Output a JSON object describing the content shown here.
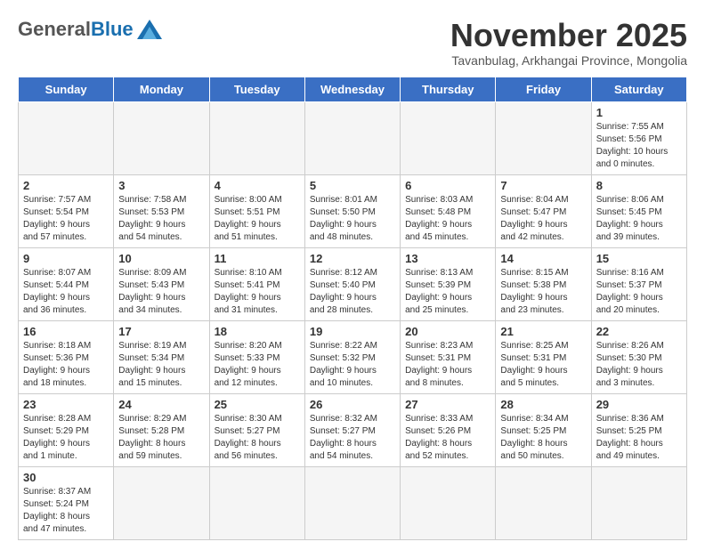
{
  "header": {
    "logo_general": "General",
    "logo_blue": "Blue",
    "month_title": "November 2025",
    "subtitle": "Tavanbulag, Arkhangai Province, Mongolia"
  },
  "weekdays": [
    "Sunday",
    "Monday",
    "Tuesday",
    "Wednesday",
    "Thursday",
    "Friday",
    "Saturday"
  ],
  "weeks": [
    [
      {
        "day": "",
        "info": ""
      },
      {
        "day": "",
        "info": ""
      },
      {
        "day": "",
        "info": ""
      },
      {
        "day": "",
        "info": ""
      },
      {
        "day": "",
        "info": ""
      },
      {
        "day": "",
        "info": ""
      },
      {
        "day": "1",
        "info": "Sunrise: 7:55 AM\nSunset: 5:56 PM\nDaylight: 10 hours\nand 0 minutes."
      }
    ],
    [
      {
        "day": "2",
        "info": "Sunrise: 7:57 AM\nSunset: 5:54 PM\nDaylight: 9 hours\nand 57 minutes."
      },
      {
        "day": "3",
        "info": "Sunrise: 7:58 AM\nSunset: 5:53 PM\nDaylight: 9 hours\nand 54 minutes."
      },
      {
        "day": "4",
        "info": "Sunrise: 8:00 AM\nSunset: 5:51 PM\nDaylight: 9 hours\nand 51 minutes."
      },
      {
        "day": "5",
        "info": "Sunrise: 8:01 AM\nSunset: 5:50 PM\nDaylight: 9 hours\nand 48 minutes."
      },
      {
        "day": "6",
        "info": "Sunrise: 8:03 AM\nSunset: 5:48 PM\nDaylight: 9 hours\nand 45 minutes."
      },
      {
        "day": "7",
        "info": "Sunrise: 8:04 AM\nSunset: 5:47 PM\nDaylight: 9 hours\nand 42 minutes."
      },
      {
        "day": "8",
        "info": "Sunrise: 8:06 AM\nSunset: 5:45 PM\nDaylight: 9 hours\nand 39 minutes."
      }
    ],
    [
      {
        "day": "9",
        "info": "Sunrise: 8:07 AM\nSunset: 5:44 PM\nDaylight: 9 hours\nand 36 minutes."
      },
      {
        "day": "10",
        "info": "Sunrise: 8:09 AM\nSunset: 5:43 PM\nDaylight: 9 hours\nand 34 minutes."
      },
      {
        "day": "11",
        "info": "Sunrise: 8:10 AM\nSunset: 5:41 PM\nDaylight: 9 hours\nand 31 minutes."
      },
      {
        "day": "12",
        "info": "Sunrise: 8:12 AM\nSunset: 5:40 PM\nDaylight: 9 hours\nand 28 minutes."
      },
      {
        "day": "13",
        "info": "Sunrise: 8:13 AM\nSunset: 5:39 PM\nDaylight: 9 hours\nand 25 minutes."
      },
      {
        "day": "14",
        "info": "Sunrise: 8:15 AM\nSunset: 5:38 PM\nDaylight: 9 hours\nand 23 minutes."
      },
      {
        "day": "15",
        "info": "Sunrise: 8:16 AM\nSunset: 5:37 PM\nDaylight: 9 hours\nand 20 minutes."
      }
    ],
    [
      {
        "day": "16",
        "info": "Sunrise: 8:18 AM\nSunset: 5:36 PM\nDaylight: 9 hours\nand 18 minutes."
      },
      {
        "day": "17",
        "info": "Sunrise: 8:19 AM\nSunset: 5:34 PM\nDaylight: 9 hours\nand 15 minutes."
      },
      {
        "day": "18",
        "info": "Sunrise: 8:20 AM\nSunset: 5:33 PM\nDaylight: 9 hours\nand 12 minutes."
      },
      {
        "day": "19",
        "info": "Sunrise: 8:22 AM\nSunset: 5:32 PM\nDaylight: 9 hours\nand 10 minutes."
      },
      {
        "day": "20",
        "info": "Sunrise: 8:23 AM\nSunset: 5:31 PM\nDaylight: 9 hours\nand 8 minutes."
      },
      {
        "day": "21",
        "info": "Sunrise: 8:25 AM\nSunset: 5:31 PM\nDaylight: 9 hours\nand 5 minutes."
      },
      {
        "day": "22",
        "info": "Sunrise: 8:26 AM\nSunset: 5:30 PM\nDaylight: 9 hours\nand 3 minutes."
      }
    ],
    [
      {
        "day": "23",
        "info": "Sunrise: 8:28 AM\nSunset: 5:29 PM\nDaylight: 9 hours\nand 1 minute."
      },
      {
        "day": "24",
        "info": "Sunrise: 8:29 AM\nSunset: 5:28 PM\nDaylight: 8 hours\nand 59 minutes."
      },
      {
        "day": "25",
        "info": "Sunrise: 8:30 AM\nSunset: 5:27 PM\nDaylight: 8 hours\nand 56 minutes."
      },
      {
        "day": "26",
        "info": "Sunrise: 8:32 AM\nSunset: 5:27 PM\nDaylight: 8 hours\nand 54 minutes."
      },
      {
        "day": "27",
        "info": "Sunrise: 8:33 AM\nSunset: 5:26 PM\nDaylight: 8 hours\nand 52 minutes."
      },
      {
        "day": "28",
        "info": "Sunrise: 8:34 AM\nSunset: 5:25 PM\nDaylight: 8 hours\nand 50 minutes."
      },
      {
        "day": "29",
        "info": "Sunrise: 8:36 AM\nSunset: 5:25 PM\nDaylight: 8 hours\nand 49 minutes."
      }
    ],
    [
      {
        "day": "30",
        "info": "Sunrise: 8:37 AM\nSunset: 5:24 PM\nDaylight: 8 hours\nand 47 minutes."
      },
      {
        "day": "",
        "info": ""
      },
      {
        "day": "",
        "info": ""
      },
      {
        "day": "",
        "info": ""
      },
      {
        "day": "",
        "info": ""
      },
      {
        "day": "",
        "info": ""
      },
      {
        "day": "",
        "info": ""
      }
    ]
  ]
}
